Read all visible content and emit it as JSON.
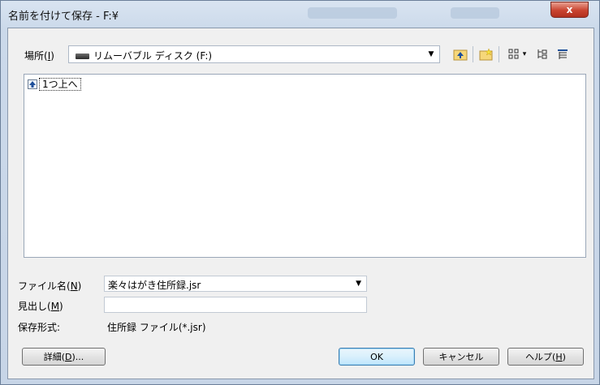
{
  "titlebar": {
    "title": "名前を付けて保存 - F:¥",
    "close_label": "x"
  },
  "location": {
    "label": "場所(",
    "accel": "I",
    "label_end": ")",
    "value": "リムーバブル ディスク (F:)"
  },
  "toolbar": {
    "icons": [
      "up-folder-icon",
      "new-folder-icon",
      "view-menu-icon",
      "tree-icon",
      "details-icon"
    ],
    "view_dropdown_arrow": "▾"
  },
  "file_list": {
    "items": [
      {
        "label": "1つ上へ",
        "icon": "up-folder-icon"
      }
    ]
  },
  "form": {
    "filename_label": "ファイル名(",
    "filename_accel": "N",
    "filename_label_end": ")",
    "filename_value": "楽々はがき住所録.jsr",
    "heading_label": "見出し(",
    "heading_accel": "M",
    "heading_label_end": ")",
    "heading_value": "",
    "format_label": "保存形式:",
    "format_value": "住所録 ファイル(*.jsr)"
  },
  "buttons": {
    "details_pre": "詳細(",
    "details_accel": "D",
    "details_post": ")...",
    "ok": "OK",
    "cancel": "キャンセル",
    "help_pre": "ヘルプ(",
    "help_accel": "H",
    "help_post": ")"
  }
}
